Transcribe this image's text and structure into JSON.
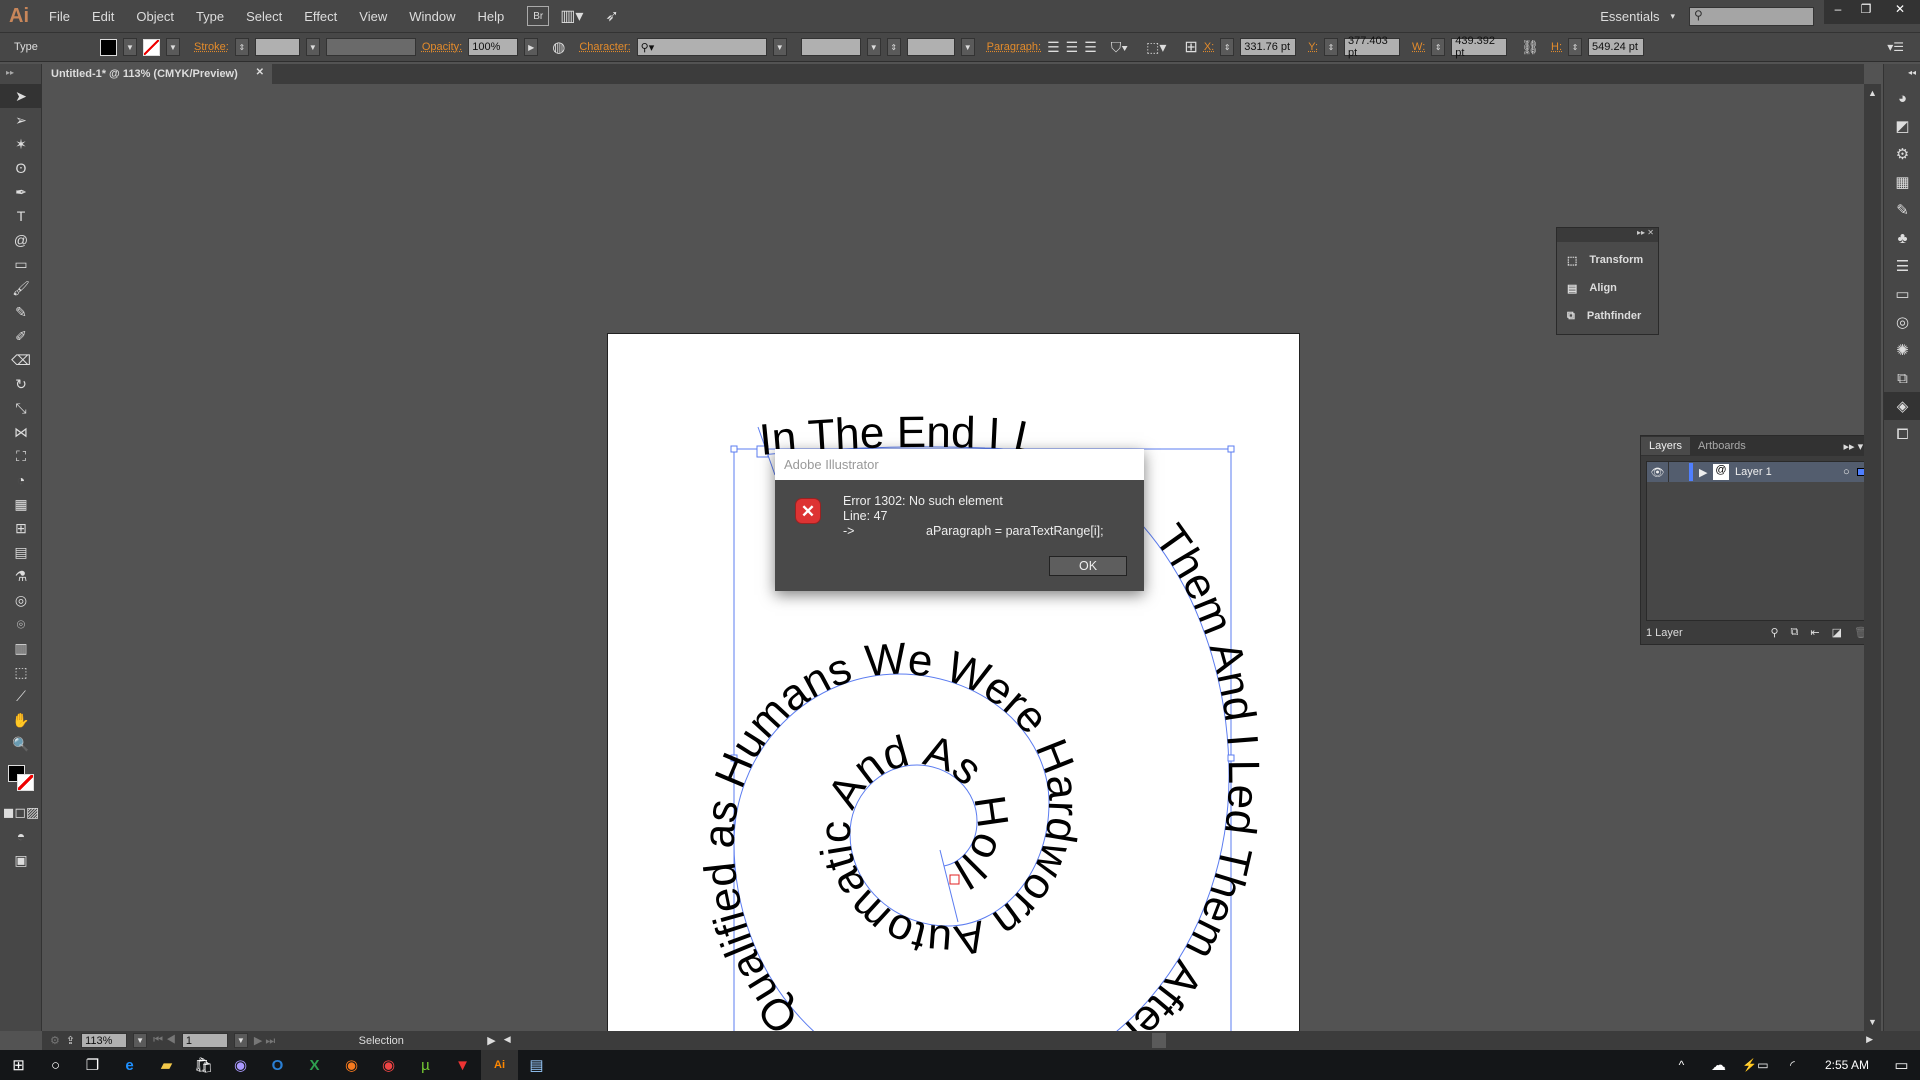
{
  "app": {
    "logo": "Ai",
    "accent": "#e38b2b"
  },
  "menu": [
    "File",
    "Edit",
    "Object",
    "Type",
    "Select",
    "Effect",
    "View",
    "Window",
    "Help"
  ],
  "menu_buttons": {
    "bridge": "Br",
    "workspace": "Essentials"
  },
  "control": {
    "mode": "Type",
    "stroke_label": "Stroke:",
    "opacity_label": "Opacity:",
    "opacity": "100%",
    "character_label": "Character:",
    "paragraph_label": "Paragraph:",
    "x_label": "X:",
    "x": "331.76 pt",
    "y_label": "Y:",
    "y": "377.403 pt",
    "w_label": "W:",
    "w": "439.392 pt",
    "h_label": "H:",
    "h": "549.24 pt"
  },
  "document_tab": {
    "title": "Untitled-1* @ 113% (CMYK/Preview)"
  },
  "artwork": {
    "spiral_segments": [
      "In The End I L",
      "Them And I Led Them After All",
      "Qualified as Humans We Were Hardworn Automatic And As Hollow As The \"O\""
    ]
  },
  "dialog": {
    "title": "Adobe Illustrator",
    "error": "Error 1302: No such element",
    "line": "Line: 47",
    "arrow": "->",
    "code": "aParagraph = paraTextRange[i];",
    "ok": "OK",
    "icon": "error-icon"
  },
  "floating_panel": {
    "items": [
      "Transform",
      "Align",
      "Pathfinder"
    ]
  },
  "layers_panel": {
    "tabs": [
      "Layers",
      "Artboards"
    ],
    "layers": [
      {
        "name": "Layer 1",
        "color": "#4f7fff"
      }
    ],
    "count": "1 Layer"
  },
  "status": {
    "zoom": "113%",
    "artboard": "1",
    "tool": "Selection"
  },
  "taskbar": {
    "time": "2:55 AM"
  }
}
